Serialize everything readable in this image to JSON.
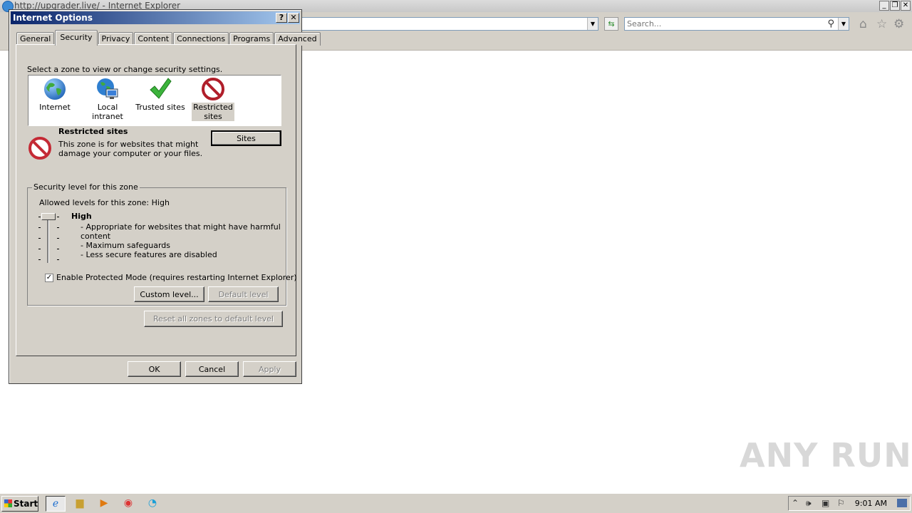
{
  "browser": {
    "title": "http://upgrader.live/ - Internet Explorer",
    "search_placeholder": "Search..."
  },
  "dialog": {
    "title": "Internet Options",
    "help_btn": "?",
    "close_btn": "✕",
    "tabs": [
      "General",
      "Security",
      "Privacy",
      "Content",
      "Connections",
      "Programs",
      "Advanced"
    ],
    "active_tab": "Security",
    "zone_prompt": "Select a zone to view or change security settings.",
    "zones": [
      {
        "label": "Internet",
        "icon": "globe-icon"
      },
      {
        "label": "Local intranet",
        "icon": "intranet-icon"
      },
      {
        "label": "Trusted sites",
        "icon": "checkmark-icon"
      },
      {
        "label_line1": "Restricted",
        "label_line2": "sites",
        "icon": "restricted-icon",
        "selected": true
      }
    ],
    "selected_zone_title": "Restricted sites",
    "selected_zone_desc_line1": "This zone is for websites that might",
    "selected_zone_desc_line2": "damage your computer or your files.",
    "sites_button": "Sites",
    "security_group_caption": "Security level for this zone",
    "allowed_levels": "Allowed levels for this zone: High",
    "level_name": "High",
    "level_desc": [
      "- Appropriate for websites that might have harmful",
      "content",
      "- Maximum safeguards",
      "- Less secure features are disabled"
    ],
    "protected_mode_label": "Enable Protected Mode (requires restarting Internet Explorer)",
    "protected_mode_checked": "✓",
    "custom_level_button": "Custom level...",
    "default_level_button": "Default level",
    "reset_all_button": "Reset all zones to default level",
    "ok_button": "OK",
    "cancel_button": "Cancel",
    "apply_button": "Apply"
  },
  "taskbar": {
    "start_label": "Start",
    "clock": "9:01 AM"
  },
  "watermark": "ANY RUN"
}
